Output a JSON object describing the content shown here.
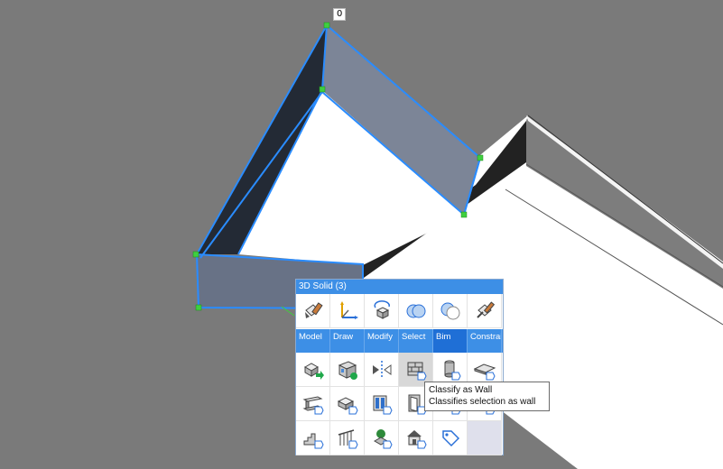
{
  "viewport": {
    "dimension_label": "0",
    "colors": {
      "background": "#7a7a7a",
      "selection": "#2a8cff",
      "grip": "#3fcf3f"
    }
  },
  "quad": {
    "title": "3D Solid (3)",
    "top_icons": [
      "paint-bucket-icon",
      "coordinate-system-icon",
      "rotate-3d-icon",
      "union-icon",
      "subtract-icon",
      "eyedropper-icon"
    ],
    "tabs": [
      {
        "label": "Model",
        "active": false
      },
      {
        "label": "Draw",
        "active": false
      },
      {
        "label": "Modify",
        "active": false
      },
      {
        "label": "Select",
        "active": false
      },
      {
        "label": "Bim",
        "active": true
      },
      {
        "label": "Constrai",
        "active": false
      }
    ],
    "tool_rows": [
      [
        "extrude-icon",
        "add-windows-icon",
        "mirror-icon",
        "classify-wall-icon",
        "classify-column-icon",
        "classify-slab-icon"
      ],
      [
        "classify-beam-icon",
        "classify-block-icon",
        "classify-window-icon",
        "classify-door-icon",
        "classify-opening-icon",
        "classify-roof-icon"
      ],
      [
        "classify-stair-icon",
        "classify-railing-icon",
        "classify-furniture-icon",
        "classify-building-icon",
        "classify-tag-icon",
        ""
      ]
    ]
  },
  "tooltip": {
    "title": "Classify as Wall",
    "description": "Classifies selection as wall"
  }
}
